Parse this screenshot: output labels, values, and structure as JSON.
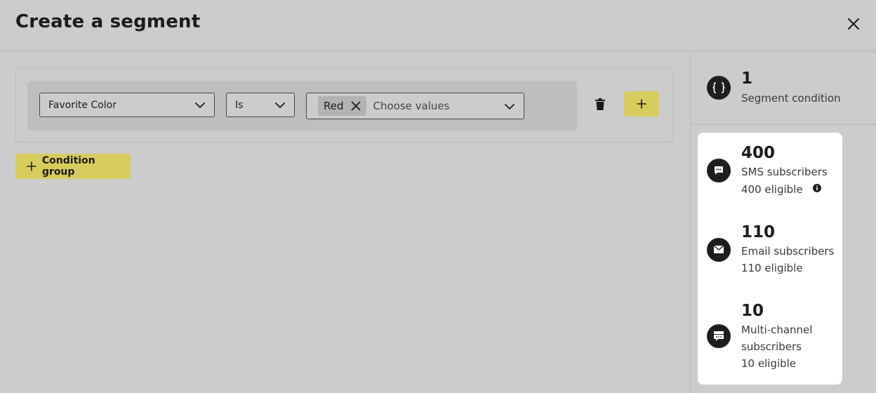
{
  "header": {
    "title": "Create a segment"
  },
  "condition": {
    "field": {
      "value": "Favorite Color"
    },
    "operator": {
      "value": "Is"
    },
    "values": {
      "chips": [
        "Red"
      ],
      "placeholder": "Choose values"
    }
  },
  "actions": {
    "condition_group_label": "Condition group"
  },
  "summary": {
    "segment_conditions": {
      "count": "1",
      "label": "Segment condition"
    },
    "stats": [
      {
        "count": "400",
        "label": "SMS subscribers",
        "eligible": "400 eligible",
        "icon": "sms-icon"
      },
      {
        "count": "110",
        "label": "Email subscribers",
        "eligible": "110 eligible",
        "icon": "email-icon"
      },
      {
        "count": "10",
        "label_line1": "Multi-channel",
        "label_line2": "subscribers",
        "eligible": "10 eligible",
        "icon": "multichannel-icon"
      }
    ]
  },
  "colors": {
    "accent": "#d9cc5e",
    "background": "#cccccc",
    "card": "#ffffff",
    "icon_circle": "#1e1e1e"
  }
}
